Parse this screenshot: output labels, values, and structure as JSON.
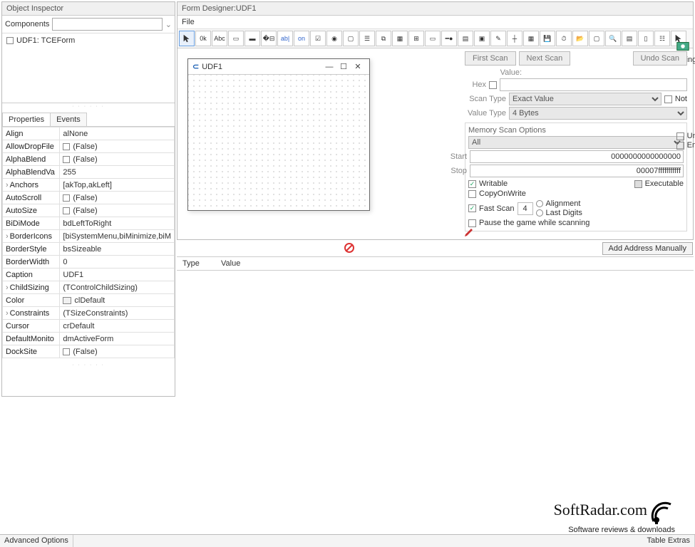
{
  "object_inspector": {
    "title": "Object Inspector",
    "components_label": "Components",
    "tree_item": "UDF1: TCEForm",
    "tabs": {
      "properties": "Properties",
      "events": "Events"
    },
    "properties": [
      {
        "name": "Align",
        "value": "alNone"
      },
      {
        "name": "AllowDropFile",
        "value": "(False)",
        "checkbox": true
      },
      {
        "name": "AlphaBlend",
        "value": "(False)",
        "checkbox": true
      },
      {
        "name": "AlphaBlendVa",
        "value": "255"
      },
      {
        "name": "Anchors",
        "value": "[akTop,akLeft]",
        "expand": true
      },
      {
        "name": "AutoScroll",
        "value": "(False)",
        "checkbox": true
      },
      {
        "name": "AutoSize",
        "value": "(False)",
        "checkbox": true
      },
      {
        "name": "BiDiMode",
        "value": "bdLeftToRight"
      },
      {
        "name": "BorderIcons",
        "value": "[biSystemMenu,biMinimize,biM",
        "expand": true
      },
      {
        "name": "BorderStyle",
        "value": "bsSizeable"
      },
      {
        "name": "BorderWidth",
        "value": "0"
      },
      {
        "name": "Caption",
        "value": "UDF1"
      },
      {
        "name": "ChildSizing",
        "value": "(TControlChildSizing)",
        "expand": true
      },
      {
        "name": "Color",
        "value": "clDefault",
        "swatch": true
      },
      {
        "name": "Constraints",
        "value": "(TSizeConstraints)",
        "expand": true
      },
      {
        "name": "Cursor",
        "value": "crDefault"
      },
      {
        "name": "DefaultMonito",
        "value": "dmActiveForm"
      },
      {
        "name": "DockSite",
        "value": "(False)",
        "checkbox": true
      }
    ]
  },
  "form_designer": {
    "title": "Form Designer:UDF1",
    "menu_file": "File",
    "window_title": "UDF1"
  },
  "scan_panel": {
    "first_scan": "First Scan",
    "next_scan": "Next Scan",
    "undo_scan": "Undo Scan",
    "value_label": "Value:",
    "hex_label": "Hex",
    "scan_type_label": "Scan Type",
    "scan_type_value": "Exact Value",
    "not_label": "Not",
    "value_type_label": "Value Type",
    "value_type_value": "4 Bytes",
    "mso_title": "Memory Scan Options",
    "mso_all": "All",
    "start_label": "Start",
    "start_value": "0000000000000000",
    "stop_label": "Stop",
    "stop_value": "00007fffffffffff",
    "writable": "Writable",
    "executable": "Executable",
    "copyonwrite": "CopyOnWrite",
    "fast_scan": "Fast Scan",
    "fast_scan_val": "4",
    "alignment": "Alignment",
    "last_digits": "Last Digits",
    "pause_label": "Pause the game while scanning",
    "unrandomizer": "Unrandomizer",
    "speedhack": "Enable Speedhack",
    "settings": "Settings"
  },
  "add_address": "Add Address Manually",
  "results": {
    "col_type": "Type",
    "col_value": "Value"
  },
  "watermark": {
    "big": "SoftRadar.com",
    "small": "Software reviews & downloads"
  },
  "status": {
    "left": "Advanced Options",
    "right": "Table Extras"
  }
}
